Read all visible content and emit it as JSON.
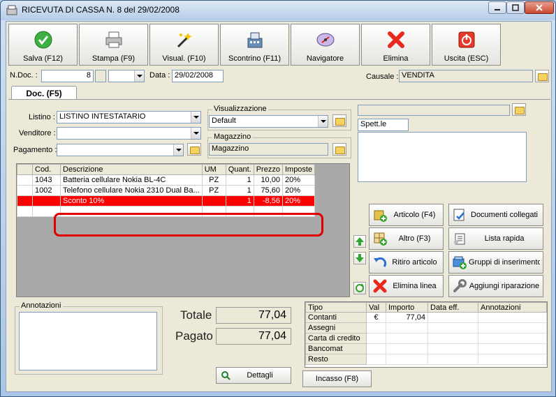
{
  "window": {
    "title": "RICEVUTA DI CASSA N. 8  del 29/02/2008"
  },
  "toolbar": [
    {
      "label": "Salva (F12)",
      "icon": "check-icon"
    },
    {
      "label": "Stampa (F9)",
      "icon": "printer-icon"
    },
    {
      "label": "Visual. (F10)",
      "icon": "magic-wand-icon"
    },
    {
      "label": "Scontrino (F11)",
      "icon": "cash-register-icon"
    },
    {
      "label": "Navigatore",
      "icon": "navigator-icon"
    },
    {
      "label": "Elimina",
      "icon": "delete-x-icon"
    },
    {
      "label": "Uscita (ESC)",
      "icon": "exit-icon"
    }
  ],
  "header": {
    "ndoc_label": "N.Doc. :",
    "ndoc_value": "8",
    "data_label": "Data :",
    "data_value": "29/02/2008",
    "causale_label": "Causale :",
    "causale_value": "VENDITA"
  },
  "tab": {
    "label": "Doc. (F5)"
  },
  "form": {
    "listino_label": "Listino :",
    "listino_value": "LISTINO INTESTATARIO",
    "venditore_label": "Venditore :",
    "venditore_value": "",
    "pagamento_label": "Pagamento :",
    "pagamento_value": "",
    "visualizzazione_label": "Visualizzazione",
    "visualizzazione_value": "Default",
    "magazzino_label": "Magazzino",
    "magazzino_value": "Magazzino",
    "cliente_value": "",
    "spett_value": "Spett.le",
    "annotazioni_label": "Annotazioni"
  },
  "grid": {
    "columns": [
      "Cod.",
      "Descrizione",
      "UM",
      "Quant.",
      "Prezzo",
      "Imposte"
    ],
    "rows": [
      {
        "cod": "1043",
        "desc": "Batteria cellulare Nokia BL-4C",
        "um": "PZ",
        "quant": "1",
        "prezzo": "10,00",
        "imposte": "20%"
      },
      {
        "cod": "1002",
        "desc": "Telefono cellulare Nokia 2310 Dual Ba...",
        "um": "PZ",
        "quant": "1",
        "prezzo": "75,60",
        "imposte": "20%"
      },
      {
        "cod": "",
        "desc": "Sconto 10%",
        "um": "",
        "quant": "1",
        "prezzo": "-8,56",
        "imposte": "20%"
      }
    ]
  },
  "actions": [
    {
      "label": "Articolo (F4)",
      "icon": "article-add-icon"
    },
    {
      "label": "Documenti collegati",
      "icon": "linked-docs-icon"
    },
    {
      "label": "Altro (F3)",
      "icon": "other-add-icon"
    },
    {
      "label": "Lista rapida",
      "icon": "quick-list-icon"
    },
    {
      "label": "Ritiro articolo",
      "icon": "undo-arrow-icon"
    },
    {
      "label": "Gruppi di inserimento",
      "icon": "group-insert-icon"
    },
    {
      "label": "Elimina linea",
      "icon": "delete-line-icon"
    },
    {
      "label": "Aggiungi riparazione",
      "icon": "wrench-icon"
    }
  ],
  "totals": {
    "totale_label": "Totale",
    "totale_value": "77,04",
    "pagato_label": "Pagato",
    "pagato_value": "77,04",
    "dettagli_label": "Dettagli",
    "incasso_label": "Incasso (F8)"
  },
  "payments": {
    "columns": [
      "Tipo",
      "Val",
      "Importo",
      "Data eff.",
      "Annotazioni"
    ],
    "rows": [
      {
        "tipo": "Contanti",
        "val": "€",
        "importo": "77,04"
      },
      {
        "tipo": "Assegni",
        "val": "",
        "importo": ""
      },
      {
        "tipo": "Carta di credito",
        "val": "",
        "importo": ""
      },
      {
        "tipo": "Bancomat",
        "val": "",
        "importo": ""
      },
      {
        "tipo": "Resto",
        "val": "",
        "importo": ""
      }
    ]
  },
  "colors": {
    "selected_row": "#ff0000",
    "highlight": "#e00000"
  }
}
